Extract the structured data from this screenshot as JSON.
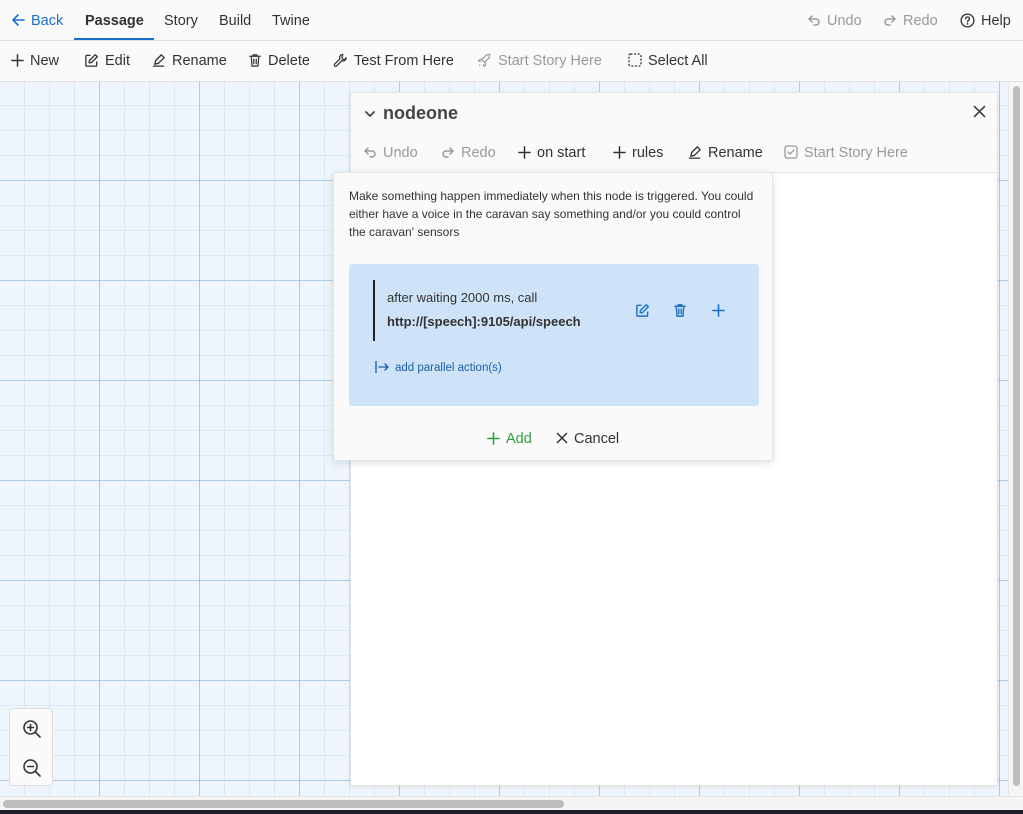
{
  "topbar": {
    "back": "Back",
    "tabs": [
      "Passage",
      "Story",
      "Build",
      "Twine"
    ],
    "undo": "Undo",
    "redo": "Redo",
    "help": "Help"
  },
  "toolbar": {
    "new": "New",
    "edit": "Edit",
    "rename": "Rename",
    "delete": "Delete",
    "test_from_here": "Test From Here",
    "start_story_here": "Start Story Here",
    "select_all": "Select All"
  },
  "editor": {
    "title": "nodeone",
    "toolbar": {
      "undo": "Undo",
      "redo": "Redo",
      "on_start": "on start",
      "rules": "rules",
      "rename": "Rename",
      "start_story_here": "Start Story Here"
    }
  },
  "popup": {
    "description": "Make something happen immediately when this node is triggered. You could either have a voice in the caravan say something and/or you could control the caravan' sensors",
    "action": {
      "line1": "after waiting 2000 ms, call",
      "line2": "http://[speech]:9105/api/speech"
    },
    "add_parallel": "add parallel action(s)",
    "add": "Add",
    "cancel": "Cancel"
  },
  "colors": {
    "accent": "#1a6fc9",
    "add_green": "#2f9e44",
    "card_bg": "#cfe3f8"
  }
}
